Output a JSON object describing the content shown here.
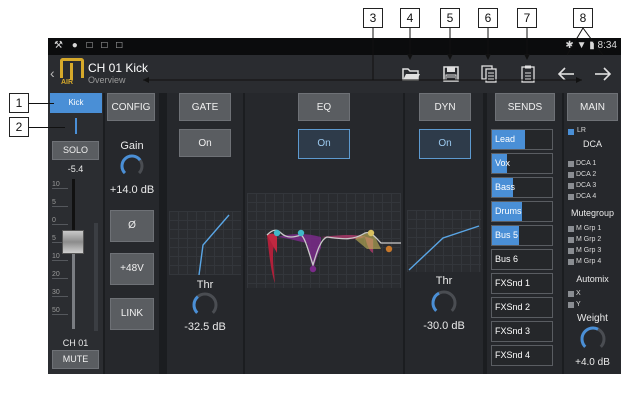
{
  "callouts": [
    "1",
    "2",
    "3",
    "4",
    "5",
    "6",
    "7",
    "8"
  ],
  "statusbar": {
    "time": "8:34"
  },
  "header": {
    "title": "CH 01 Kick",
    "subtitle": "Overview",
    "logo_text": "AIR"
  },
  "toolbar": [
    "folder-open-icon",
    "save-icon",
    "copy-icon",
    "paste-icon",
    "back-arrow-icon",
    "forward-arrow-icon"
  ],
  "channel": {
    "name_button": "Kick",
    "solo_label": "SOLO",
    "fader_value": "-5.4",
    "fader_scale": [
      "10",
      "5",
      "0",
      "5",
      "10",
      "20",
      "30",
      "50"
    ],
    "fader_level": 0.58,
    "meter_level": 0.0,
    "footer_label": "CH 01",
    "mute_label": "MUTE"
  },
  "config": {
    "header": "CONFIG",
    "gain_label": "Gain",
    "gain_value": "+14.0 dB",
    "gain_knob": 0.7,
    "phase_label": "Ø",
    "phantom_label": "+48V",
    "link_label": "LINK"
  },
  "gate": {
    "header": "GATE",
    "on_label": "On",
    "thr_label": "Thr",
    "thr_value": "-32.5 dB",
    "thr_knob": 0.35
  },
  "eq": {
    "header": "EQ",
    "on_label": "On"
  },
  "dyn": {
    "header": "DYN",
    "on_label": "On",
    "thr_label": "Thr",
    "thr_value": "-30.0 dB",
    "thr_knob": 0.4
  },
  "sends": {
    "header": "SENDS",
    "rows": [
      {
        "label": "Lead",
        "level": 0.55
      },
      {
        "label": "Vox",
        "level": 0.25
      },
      {
        "label": "Bass",
        "level": 0.35
      },
      {
        "label": "Drums",
        "level": 0.5
      },
      {
        "label": "Bus 5",
        "level": 0.45
      },
      {
        "label": "Bus 6",
        "level": 0.0
      },
      {
        "label": "FXSnd 1",
        "level": 0.0
      },
      {
        "label": "FXSnd 2",
        "level": 0.0
      },
      {
        "label": "FXSnd 3",
        "level": 0.0
      },
      {
        "label": "FXSnd 4",
        "level": 0.0
      }
    ]
  },
  "main": {
    "header": "MAIN",
    "lr_label": "LR",
    "dca_title": "DCA",
    "dca": [
      "DCA 1",
      "DCA 2",
      "DCA 3",
      "DCA 4"
    ],
    "mutegroup_title": "Mutegroup",
    "mutegroups": [
      "M Grp 1",
      "M Grp 2",
      "M Grp 3",
      "M Grp 4"
    ],
    "automix_title": "Automix",
    "automix": [
      "X",
      "Y"
    ],
    "weight_label": "Weight",
    "weight_value": "+4.0 dB",
    "weight_knob": 0.6
  },
  "colors": {
    "accent": "#4a8fd6",
    "logo": "#d6a92a",
    "eq_red": "#b0203a",
    "eq_purple": "#7a2a8a",
    "eq_yellow": "#d8c060",
    "eq_cyan": "#40b8c8"
  }
}
